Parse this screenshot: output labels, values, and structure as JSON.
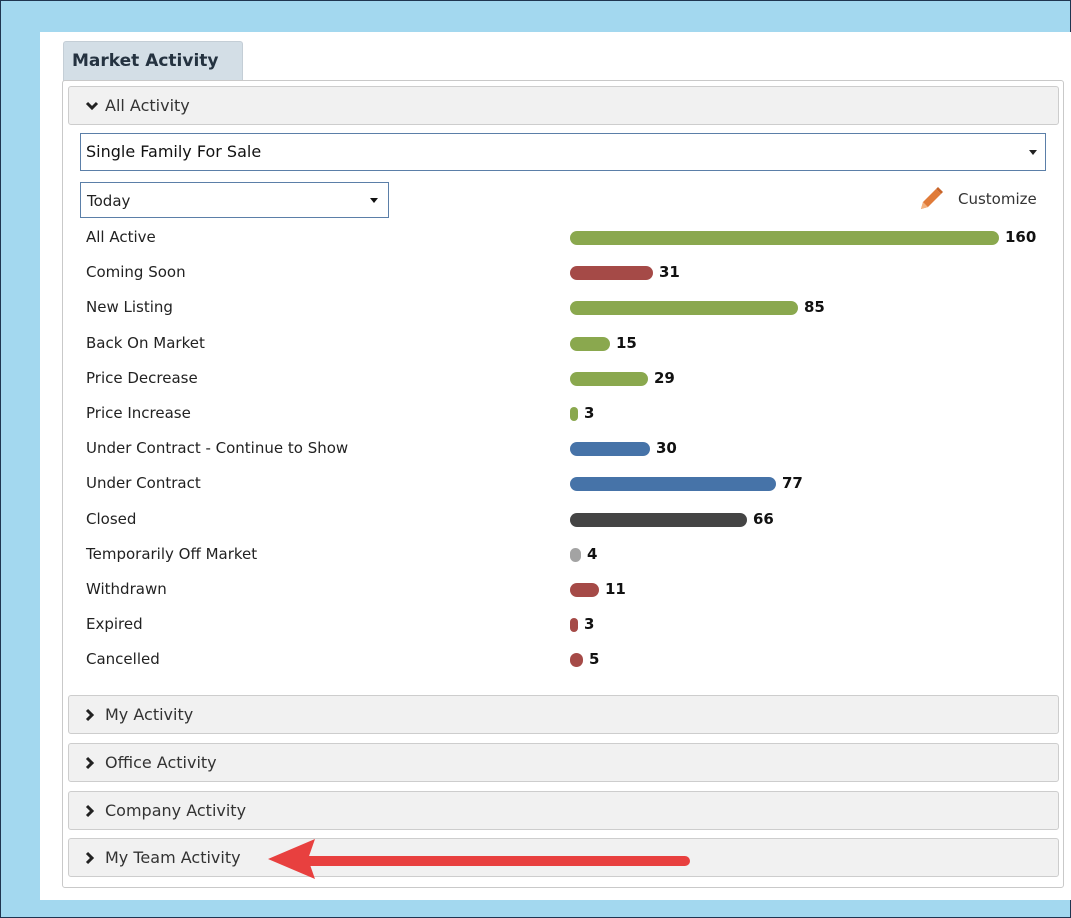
{
  "tab": {
    "title": "Market Activity"
  },
  "sections": {
    "all": {
      "label": "All Activity",
      "expanded": true
    },
    "my": {
      "label": "My Activity"
    },
    "office": {
      "label": "Office Activity"
    },
    "company": {
      "label": "Company Activity"
    },
    "team": {
      "label": "My Team Activity"
    }
  },
  "filters": {
    "property_type": "Single Family For Sale",
    "period": "Today",
    "customize_label": "Customize"
  },
  "colors": {
    "green": "#8aa84e",
    "red": "#a54a47",
    "blue": "#4673a8",
    "dark": "#444444",
    "gray": "#a3a3a3",
    "arrow": "#e8403f",
    "pencil": "#e07b39"
  },
  "chart_data": {
    "type": "bar",
    "orientation": "horizontal",
    "categories": [
      "All Active",
      "Coming Soon",
      "New Listing",
      "Back On Market",
      "Price Decrease",
      "Price Increase",
      "Under Contract - Continue to Show",
      "Under Contract",
      "Closed",
      "Temporarily Off Market",
      "Withdrawn",
      "Expired",
      "Cancelled"
    ],
    "values": [
      160,
      31,
      85,
      15,
      29,
      3,
      30,
      77,
      66,
      4,
      11,
      3,
      5
    ],
    "bar_colors": [
      "green",
      "red",
      "green",
      "green",
      "green",
      "green",
      "blue",
      "blue",
      "dark",
      "gray",
      "red",
      "red",
      "red"
    ],
    "value_labels": [
      "160",
      "31",
      "85",
      "15",
      "29",
      "3",
      "30",
      "77",
      "66",
      "4",
      "11",
      "3",
      "5"
    ]
  }
}
